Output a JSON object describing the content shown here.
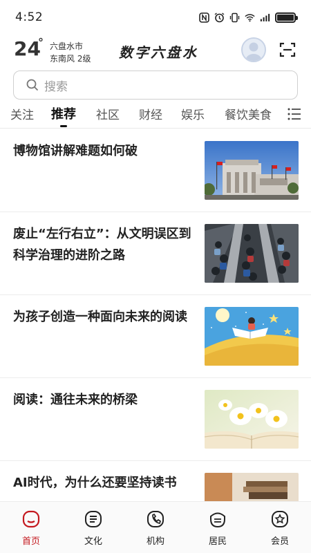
{
  "status_bar": {
    "time": "4:52",
    "icons": [
      "nfc-icon",
      "alarm-icon",
      "vibrate-icon",
      "wifi-icon",
      "signal-icon",
      "battery-icon"
    ]
  },
  "header": {
    "temperature": "24",
    "degree": "°",
    "city": "六盘水市",
    "wind": "东南风  2级",
    "brand": "数字六盘水"
  },
  "search": {
    "placeholder": "搜索"
  },
  "tabs": {
    "items": [
      "关注",
      "推荐",
      "社区",
      "财经",
      "娱乐",
      "餐饮美食"
    ],
    "active": "推荐"
  },
  "news": [
    {
      "title": "博物馆讲解难题如何破",
      "thumb": "museum-building-image"
    },
    {
      "title": "废止“左行右立”：从文明误区到科学治理的进阶之路",
      "thumb": "escalator-crowd-image"
    },
    {
      "title": "为孩子创造一种面向未来的阅读",
      "thumb": "child-reading-on-moon-illustration"
    },
    {
      "title": "阅读：通往未来的桥梁",
      "thumb": "open-book-daisies-image"
    },
    {
      "title": "AI时代，为什么还要坚持读书",
      "thumb": "books-on-desk-image"
    }
  ],
  "bottom_nav": {
    "items": [
      {
        "label": "首页",
        "icon": "home-icon"
      },
      {
        "label": "文化",
        "icon": "culture-icon"
      },
      {
        "label": "机构",
        "icon": "institution-icon"
      },
      {
        "label": "居民",
        "icon": "resident-icon"
      },
      {
        "label": "会员",
        "icon": "member-icon"
      }
    ],
    "active": "首页"
  },
  "colors": {
    "accent": "#c4191f",
    "text": "#222222",
    "muted": "#999999"
  }
}
